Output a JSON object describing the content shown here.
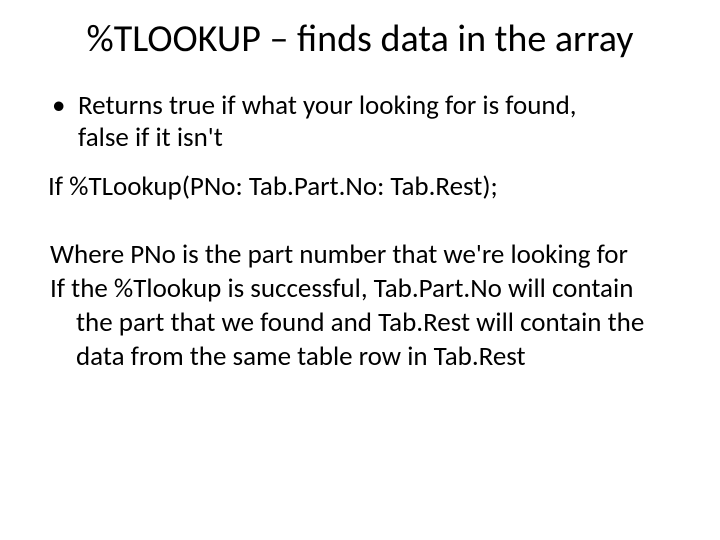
{
  "title": "%TLOOKUP – finds data in the array",
  "bullet1_line1": "Returns true if what your looking for is found,",
  "bullet1_line2": "false if it isn't",
  "code_line": "If  %TLookup(PNo: Tab.Part.No: Tab.Rest);",
  "para1": "Where PNo is the part number that we're looking for",
  "para2_l1": "If the %Tlookup is successful, Tab.Part.No will contain",
  "para2_l2": "the part that we found and Tab.Rest will contain the",
  "para2_l3": "data from the same table row in Tab.Rest"
}
